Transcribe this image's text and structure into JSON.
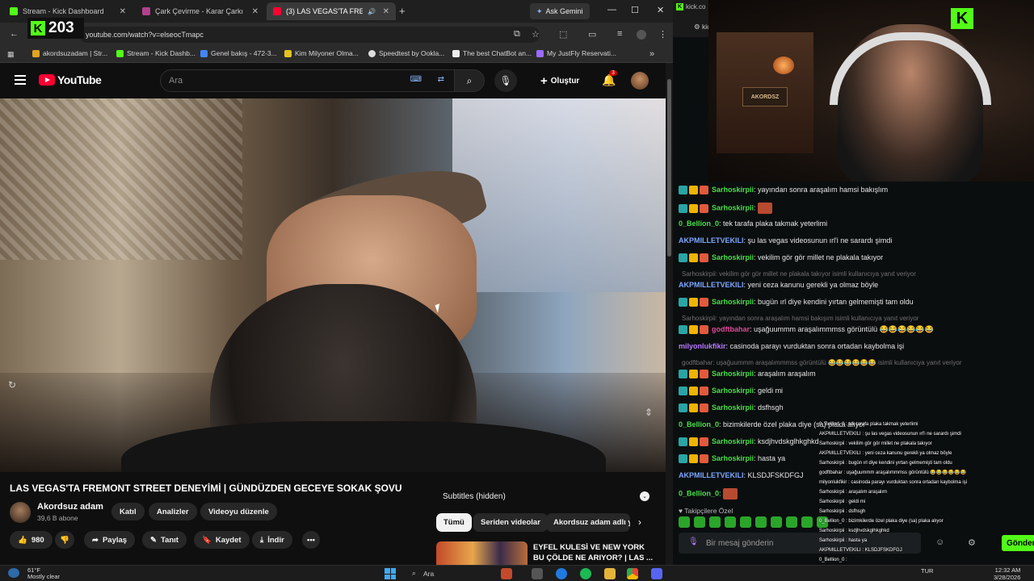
{
  "browser": {
    "tabs": [
      {
        "label": "Stream - Kick Dashboard",
        "color": "#53fc18"
      },
      {
        "label": "Çark Çevirme - Karar Çarkı",
        "color": "#b1418c"
      },
      {
        "label": "(3) LAS VEGAS'TA FREMON",
        "color": "#ff0033"
      }
    ],
    "gemini_label": "Ask Gemini",
    "url": "youtube.com/watch?v=elseocTmapc",
    "kick_viewers": "203",
    "bookmarks": [
      {
        "label": "akordsuzadam | Str...",
        "color": "#e2a320"
      },
      {
        "label": "Stream - Kick Dashb...",
        "color": "#53fc18"
      },
      {
        "label": "Genel bakış - 472-3...",
        "color": "#4285f4"
      },
      {
        "label": "Kim Milyoner Olma...",
        "color": "#e2c320"
      },
      {
        "label": "Speedtest by Ookla...",
        "color": "#dddddd"
      },
      {
        "label": "The best ChatBot an...",
        "color": "#eeeeee"
      },
      {
        "label": "My JustFly Reservati...",
        "color": "#9c6bff"
      }
    ]
  },
  "youtube": {
    "logo_text": "YouTube",
    "search_placeholder": "Ara",
    "create_label": "Oluştur",
    "notif_count": "3",
    "video_title": "LAS VEGAS'TA FREMONT STREET DENEYİMİ | GÜNDÜZDEN GECEYE SOKAK ŞOVU",
    "channel_name": "Akordsuz adam",
    "subscriber_count": "39,6 B abone",
    "channel_buttons": [
      "Katıl",
      "Analizler",
      "Videoyu düzenle"
    ],
    "like_count": "980",
    "actions": {
      "share": "Paylaş",
      "clip": "Tanıt",
      "save": "Kaydet",
      "download": "İndir",
      "more": "•••"
    },
    "subtitles_label": "Subtitles (hidden)",
    "chips": [
      "Tümü",
      "Seriden videolar",
      "Akordsuz adam adlı y"
    ],
    "rec_title": "EYFEL KULESİ VE NEW YORK BU ÇÖLDE NE ARIYOR? | LAS ..."
  },
  "kick": {
    "tab_label": "kick.co",
    "url_fragment": "kick",
    "webcam_sign": "AKORDSZ",
    "messages": [
      {
        "user": "Sarhoskirpii",
        "color": "#4ade4a",
        "text": "yayından sonra araşalım hamsi bakışlım",
        "badges": true
      },
      {
        "user": "Sarhoskirpii",
        "color": "#4ade4a",
        "text": "",
        "badges": true,
        "emote": true
      },
      {
        "user": "0_Bellion_0",
        "color": "#4ade4a",
        "text": "tek tarafa plaka takmak yeterlimi",
        "badges": false
      },
      {
        "user": "AKPMILLETVEKILI",
        "color": "#7aa7ff",
        "text": "şu las vegas videosunun ırl'i ne sarardı şimdi",
        "badges": false
      },
      {
        "user": "Sarhoskirpii",
        "color": "#4ade4a",
        "text": "vekilim gör gör millet ne plakala takıyor",
        "badges": true
      },
      {
        "user": "AKPMILLETVEKILI",
        "color": "#7aa7ff",
        "text": "yeni ceza kanunu gerekli ya olmaz böyle",
        "badges": false,
        "reply": "Sarhoskirpii: vekilim gör gör millet ne plakala takıyor isimli kullanıcıya yanıt veriyor"
      },
      {
        "user": "Sarhoskirpii",
        "color": "#4ade4a",
        "text": "bugün ırl diye kendini yırtan gelmemişti tam oldu",
        "badges": true
      },
      {
        "user": "godftbahar",
        "color": "#e04a9a",
        "text": "uşağuummm araşalımmmss görüntülü 😂😂😂😂😂😂",
        "badges": true,
        "reply": "Sarhoskirpii: yayından sonra araşalım hamsi bakışım isimli kullanıcıya yanıt veriyor"
      },
      {
        "user": "milyonlukfikir",
        "color": "#b77aff",
        "text": "casinoda parayı vurduktan sonra ortadan kaybolma işi",
        "badges": false
      },
      {
        "user": "Sarhoskirpii",
        "color": "#4ade4a",
        "text": "araşalım araşalım",
        "badges": true,
        "reply": "godftbahar: uşağuummm araşalımmmss görüntülü 😂😂😂😂😂😂 isimli kullanıcıya yanıt veriyor"
      },
      {
        "user": "Sarhoskirpii",
        "color": "#4ade4a",
        "text": "geldi mi",
        "badges": true
      },
      {
        "user": "Sarhoskirpii",
        "color": "#4ade4a",
        "text": "dsfhsgh",
        "badges": true
      },
      {
        "user": "0_Bellion_0",
        "color": "#4ade4a",
        "text": "bizimkilerde özel plaka diye (sa) plaka alıyor",
        "badges": false
      },
      {
        "user": "Sarhoskirpii",
        "color": "#4ade4a",
        "text": "ksdjhvdskglhkghkd",
        "badges": true
      },
      {
        "user": "Sarhoskirpii",
        "color": "#4ade4a",
        "text": "hasta ya",
        "badges": true
      },
      {
        "user": "AKPMILLETVEKILI",
        "color": "#7aa7ff",
        "text": "KLSDJFSKDFGJ",
        "badges": false
      },
      {
        "user": "0_Bellion_0",
        "color": "#4ade4a",
        "text": "",
        "badges": false,
        "emote": true
      }
    ],
    "followers_label": "Takipçilere Özel",
    "input_placeholder": "Bir mesaj gönderin",
    "send_label": "Gönder",
    "overlay_lines": [
      "0_Bellion_0 : tek tarafa plaka takmak yeterlimi",
      "AKPMILLETVEKILI : şu las vegas videosunun ırl'i ne sarardı şimdi",
      "Sarhoskirpii : vekilim gör gör millet ne plakala takıyor",
      "AKPMILLETVEKILI : yeni ceza kanunu gerekli ya olmaz böyle",
      "Sarhoskirpii : bugün ırl diye kendini yırtan gelmemişti tam oldu",
      "godftbahar : uşağuummm araşalımmmss görüntülü 😂😂😂😂😂😂",
      "milyonlukfikir : casinoda parayı vurduktan sonra ortadan kaybolma işi",
      "Sarhoskirpii : araşalım araşalım",
      "Sarhoskirpii : geldi mi",
      "Sarhoskirpii : dsfhsgh",
      "0_Bellion_0 : bizimkilerde özel plaka diye (sa) plaka alıyor",
      "Sarhoskirpii : ksdjhvdskglhkghkd",
      "Sarhoskirpii : hasta ya",
      "AKPMILLETVEKILI : KLSDJFSKDFGJ",
      "0_Bellion_0 :"
    ]
  },
  "taskbar": {
    "temp": "61°F",
    "weather": "Mostly clear",
    "search_label": "Ara",
    "lang": "TUR",
    "time": "12:32 AM",
    "date": "3/28/2026"
  }
}
